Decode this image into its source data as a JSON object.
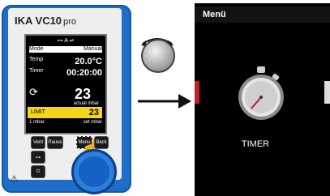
{
  "device": {
    "brand_model": "IKA VC10",
    "model_suffix": "pro",
    "status_icons": "⊶ A ⇌",
    "mode_label": "Mode",
    "mode_value": "Manual",
    "temp_label": "Temp",
    "temp_value": "20.0°C",
    "timer_label": "Timer",
    "timer_value": "00:20:00",
    "actual_value": "23",
    "actual_label": "actual mbar",
    "limit_label": "LIMIT",
    "limit_value": "23",
    "set_left": "1 mbar",
    "set_right": "set mbar",
    "buttons": [
      "Vent",
      "Pause",
      "Menu",
      "Back"
    ]
  },
  "menu_screen": {
    "title": "Menü",
    "selected_item": "TIMER"
  },
  "colors": {
    "device_blue": "#1e6ec8",
    "limit_yellow": "#f5d51a",
    "arrow_red": "#d0102a"
  }
}
